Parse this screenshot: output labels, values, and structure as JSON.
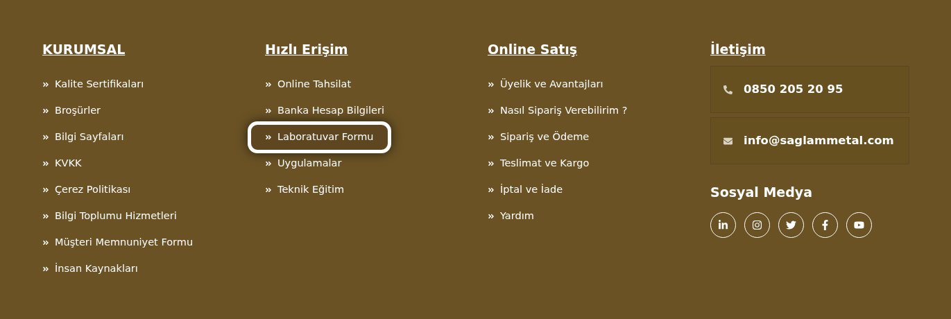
{
  "columns": [
    {
      "heading": "KURUMSAL",
      "links": [
        {
          "label": "Kalite Sertifikaları",
          "highlighted": false
        },
        {
          "label": "Broşürler",
          "highlighted": false
        },
        {
          "label": "Bilgi Sayfaları",
          "highlighted": false
        },
        {
          "label": "KVKK",
          "highlighted": false
        },
        {
          "label": "Çerez Politikası",
          "highlighted": false
        },
        {
          "label": "Bilgi Toplumu Hizmetleri",
          "highlighted": false
        },
        {
          "label": "Müşteri Memnuniyet Formu",
          "highlighted": false
        },
        {
          "label": "İnsan Kaynakları",
          "highlighted": false
        }
      ]
    },
    {
      "heading": "Hızlı Erişim",
      "links": [
        {
          "label": "Online Tahsilat",
          "highlighted": false
        },
        {
          "label": "Banka Hesap Bilgileri",
          "highlighted": false
        },
        {
          "label": "Laboratuvar Formu",
          "highlighted": true
        },
        {
          "label": "Uygulamalar",
          "highlighted": false
        },
        {
          "label": "Teknik Eğitim",
          "highlighted": false
        }
      ]
    },
    {
      "heading": "Online Satış",
      "links": [
        {
          "label": "Üyelik ve Avantajları",
          "highlighted": false
        },
        {
          "label": "Nasıl Sipariş Verebilirim ?",
          "highlighted": false
        },
        {
          "label": "Sipariş ve Ödeme",
          "highlighted": false
        },
        {
          "label": "Teslimat ve Kargo",
          "highlighted": false
        },
        {
          "label": "İptal ve İade",
          "highlighted": false
        },
        {
          "label": "Yardım",
          "highlighted": false
        }
      ]
    }
  ],
  "contact": {
    "heading": "İletişim",
    "items": [
      {
        "kind": "phone",
        "text": "0850 205 20 95"
      },
      {
        "kind": "email",
        "text": "info@saglammetal.com"
      }
    ]
  },
  "social": {
    "heading": "Sosyal Medya",
    "links": [
      {
        "kind": "linkedin"
      },
      {
        "kind": "instagram"
      },
      {
        "kind": "twitter"
      },
      {
        "kind": "facebook"
      },
      {
        "kind": "youtube"
      }
    ]
  }
}
